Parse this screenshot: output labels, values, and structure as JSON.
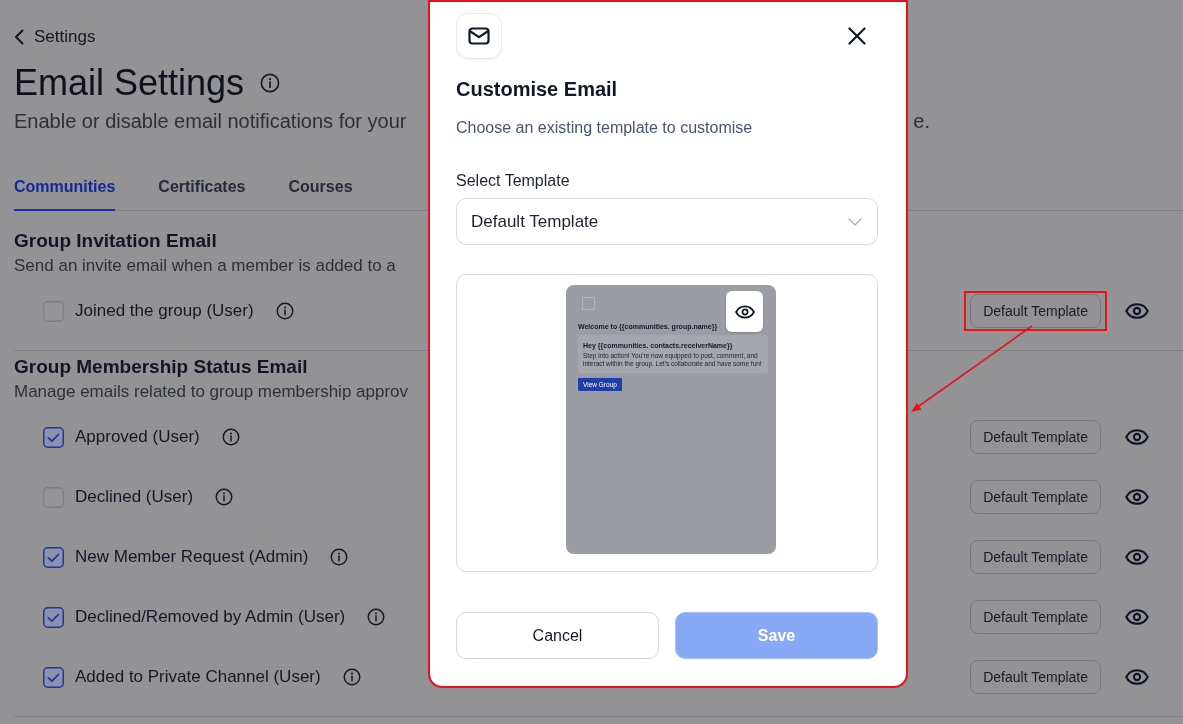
{
  "back_link": {
    "label": "Settings"
  },
  "header": {
    "title": "Email Settings",
    "subtitle": "Enable or disable email notifications for your",
    "subtitle_end": "e."
  },
  "tabs": [
    {
      "label": "Communities",
      "selected": true
    },
    {
      "label": "Certificates",
      "selected": false
    },
    {
      "label": "Courses",
      "selected": false
    }
  ],
  "sections": [
    {
      "title": "Group Invitation Email",
      "description": "Send an invite email when a member is added to a",
      "items": [
        {
          "label": "Joined the group (User)",
          "checked": false,
          "template": "Default Template",
          "highlighted": true
        }
      ]
    },
    {
      "title": "Group Membership Status Email",
      "description": "Manage emails related to group membership approv",
      "items": [
        {
          "label": "Approved (User)",
          "checked": true,
          "template": "Default Template",
          "highlighted": false
        },
        {
          "label": "Declined (User)",
          "checked": false,
          "template": "Default Template",
          "highlighted": false
        },
        {
          "label": "New Member Request (Admin)",
          "checked": true,
          "template": "Default Template",
          "highlighted": false
        },
        {
          "label": "Declined/Removed by Admin (User)",
          "checked": true,
          "template": "Default Template",
          "highlighted": false
        },
        {
          "label": "Added to Private Channel (User)",
          "checked": true,
          "template": "Default Template",
          "highlighted": false
        }
      ]
    }
  ],
  "dialog": {
    "highlighted": true,
    "title": "Customise Email",
    "subtitle": "Choose an existing template to customise",
    "select": {
      "label": "Select Template",
      "value": "Default Template"
    },
    "preview": {
      "heading": "Welcome to {{communities. group.name}}",
      "greeting": "Hey {{communities. contacts.receiverName}}",
      "body": "Step into action! You're now equipped to post, comment, and interact within the group. Let's collaborate and have some fun!",
      "button": "View Group"
    },
    "buttons": [
      {
        "label": "Cancel",
        "kind": "secondary",
        "disabled": false
      },
      {
        "label": "Save",
        "kind": "primary",
        "disabled": true
      }
    ]
  }
}
